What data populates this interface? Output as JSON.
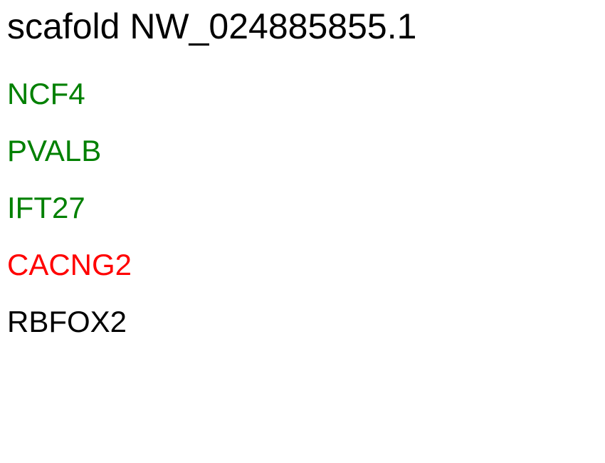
{
  "title": "scafold NW_024885855.1",
  "genes": [
    {
      "name": "NCF4",
      "color": "#008000"
    },
    {
      "name": "PVALB",
      "color": "#008000"
    },
    {
      "name": "IFT27",
      "color": "#008000"
    },
    {
      "name": "CACNG2",
      "color": "#ff0000"
    },
    {
      "name": "RBFOX2",
      "color": "#000000"
    }
  ]
}
